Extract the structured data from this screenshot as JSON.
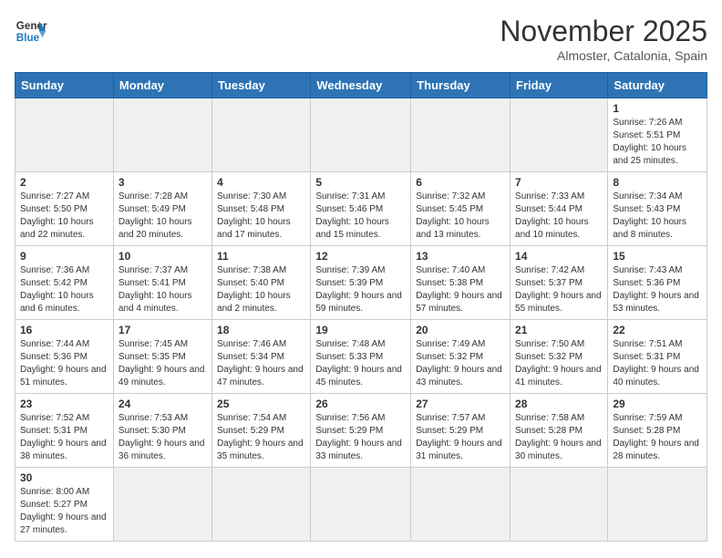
{
  "header": {
    "logo_general": "General",
    "logo_blue": "Blue",
    "month_title": "November 2025",
    "location": "Almoster, Catalonia, Spain"
  },
  "weekdays": [
    "Sunday",
    "Monday",
    "Tuesday",
    "Wednesday",
    "Thursday",
    "Friday",
    "Saturday"
  ],
  "weeks": [
    [
      {
        "day": "",
        "info": ""
      },
      {
        "day": "",
        "info": ""
      },
      {
        "day": "",
        "info": ""
      },
      {
        "day": "",
        "info": ""
      },
      {
        "day": "",
        "info": ""
      },
      {
        "day": "",
        "info": ""
      },
      {
        "day": "1",
        "info": "Sunrise: 7:26 AM\nSunset: 5:51 PM\nDaylight: 10 hours\nand 25 minutes."
      }
    ],
    [
      {
        "day": "2",
        "info": "Sunrise: 7:27 AM\nSunset: 5:50 PM\nDaylight: 10 hours\nand 22 minutes."
      },
      {
        "day": "3",
        "info": "Sunrise: 7:28 AM\nSunset: 5:49 PM\nDaylight: 10 hours\nand 20 minutes."
      },
      {
        "day": "4",
        "info": "Sunrise: 7:30 AM\nSunset: 5:48 PM\nDaylight: 10 hours\nand 17 minutes."
      },
      {
        "day": "5",
        "info": "Sunrise: 7:31 AM\nSunset: 5:46 PM\nDaylight: 10 hours\nand 15 minutes."
      },
      {
        "day": "6",
        "info": "Sunrise: 7:32 AM\nSunset: 5:45 PM\nDaylight: 10 hours\nand 13 minutes."
      },
      {
        "day": "7",
        "info": "Sunrise: 7:33 AM\nSunset: 5:44 PM\nDaylight: 10 hours\nand 10 minutes."
      },
      {
        "day": "8",
        "info": "Sunrise: 7:34 AM\nSunset: 5:43 PM\nDaylight: 10 hours\nand 8 minutes."
      }
    ],
    [
      {
        "day": "9",
        "info": "Sunrise: 7:36 AM\nSunset: 5:42 PM\nDaylight: 10 hours\nand 6 minutes."
      },
      {
        "day": "10",
        "info": "Sunrise: 7:37 AM\nSunset: 5:41 PM\nDaylight: 10 hours\nand 4 minutes."
      },
      {
        "day": "11",
        "info": "Sunrise: 7:38 AM\nSunset: 5:40 PM\nDaylight: 10 hours\nand 2 minutes."
      },
      {
        "day": "12",
        "info": "Sunrise: 7:39 AM\nSunset: 5:39 PM\nDaylight: 9 hours\nand 59 minutes."
      },
      {
        "day": "13",
        "info": "Sunrise: 7:40 AM\nSunset: 5:38 PM\nDaylight: 9 hours\nand 57 minutes."
      },
      {
        "day": "14",
        "info": "Sunrise: 7:42 AM\nSunset: 5:37 PM\nDaylight: 9 hours\nand 55 minutes."
      },
      {
        "day": "15",
        "info": "Sunrise: 7:43 AM\nSunset: 5:36 PM\nDaylight: 9 hours\nand 53 minutes."
      }
    ],
    [
      {
        "day": "16",
        "info": "Sunrise: 7:44 AM\nSunset: 5:36 PM\nDaylight: 9 hours\nand 51 minutes."
      },
      {
        "day": "17",
        "info": "Sunrise: 7:45 AM\nSunset: 5:35 PM\nDaylight: 9 hours\nand 49 minutes."
      },
      {
        "day": "18",
        "info": "Sunrise: 7:46 AM\nSunset: 5:34 PM\nDaylight: 9 hours\nand 47 minutes."
      },
      {
        "day": "19",
        "info": "Sunrise: 7:48 AM\nSunset: 5:33 PM\nDaylight: 9 hours\nand 45 minutes."
      },
      {
        "day": "20",
        "info": "Sunrise: 7:49 AM\nSunset: 5:32 PM\nDaylight: 9 hours\nand 43 minutes."
      },
      {
        "day": "21",
        "info": "Sunrise: 7:50 AM\nSunset: 5:32 PM\nDaylight: 9 hours\nand 41 minutes."
      },
      {
        "day": "22",
        "info": "Sunrise: 7:51 AM\nSunset: 5:31 PM\nDaylight: 9 hours\nand 40 minutes."
      }
    ],
    [
      {
        "day": "23",
        "info": "Sunrise: 7:52 AM\nSunset: 5:31 PM\nDaylight: 9 hours\nand 38 minutes."
      },
      {
        "day": "24",
        "info": "Sunrise: 7:53 AM\nSunset: 5:30 PM\nDaylight: 9 hours\nand 36 minutes."
      },
      {
        "day": "25",
        "info": "Sunrise: 7:54 AM\nSunset: 5:29 PM\nDaylight: 9 hours\nand 35 minutes."
      },
      {
        "day": "26",
        "info": "Sunrise: 7:56 AM\nSunset: 5:29 PM\nDaylight: 9 hours\nand 33 minutes."
      },
      {
        "day": "27",
        "info": "Sunrise: 7:57 AM\nSunset: 5:29 PM\nDaylight: 9 hours\nand 31 minutes."
      },
      {
        "day": "28",
        "info": "Sunrise: 7:58 AM\nSunset: 5:28 PM\nDaylight: 9 hours\nand 30 minutes."
      },
      {
        "day": "29",
        "info": "Sunrise: 7:59 AM\nSunset: 5:28 PM\nDaylight: 9 hours\nand 28 minutes."
      }
    ],
    [
      {
        "day": "30",
        "info": "Sunrise: 8:00 AM\nSunset: 5:27 PM\nDaylight: 9 hours\nand 27 minutes."
      },
      {
        "day": "",
        "info": ""
      },
      {
        "day": "",
        "info": ""
      },
      {
        "day": "",
        "info": ""
      },
      {
        "day": "",
        "info": ""
      },
      {
        "day": "",
        "info": ""
      },
      {
        "day": "",
        "info": ""
      }
    ]
  ]
}
